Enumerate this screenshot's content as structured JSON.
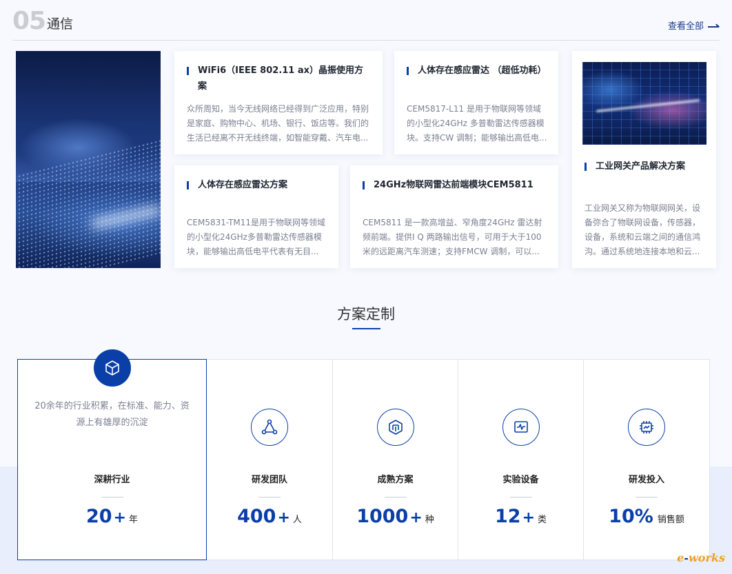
{
  "header": {
    "number": "05",
    "title": "通信",
    "view_all": "查看全部"
  },
  "cards": [
    {
      "title": "WiFi6（IEEE 802.11 ax）晶振使用方案",
      "desc": "众所周知，当今无线网络已经得到广泛应用，特别是家庭、购物中心、机场、银行、饭店等。我们的生活已经离不开无线终端，如智能穿戴、汽车电..."
    },
    {
      "title": "人体存在感应雷达 （超低功耗）",
      "desc": "CEM5817-L11 是用于物联网等领域的小型化24GHz 多普勒雷达传感器模块。支持CW 调制；能够输出高低电..."
    },
    {
      "title": "人体存在感应雷达方案",
      "desc": "CEM5831-TM11是用于物联网等领域的小型化24GHz多普勒雷达传感器模块，能够输出高低电平代表有无目..."
    },
    {
      "title": "24GHz物联网雷达前端模块CEM5811",
      "desc": "CEM5811 是一款高增益、窄角度24GHz 雷达射频前端。提供I Q 两路输出信号，可用于大于100米的远距离汽车测速；支持FMCW 调制，可以..."
    },
    {
      "title": "工业网关产品解决方案",
      "desc": "工业网关又称为物联网网关，设备弥合了物联网设备，传感器，设备，系统和云端之间的通信鸿沟。通过系统地连接本地和云..."
    }
  ],
  "customize": {
    "title": "方案定制",
    "stats": [
      {
        "label": "深耕行业",
        "num": "20",
        "plus": "+",
        "unit": "年",
        "icon": "cube-icon",
        "desc": "20余年的行业积累，在标准、能力、资源上有雄厚的沉淀"
      },
      {
        "label": "研发团队",
        "num": "400",
        "plus": "+",
        "unit": "人",
        "icon": "network-icon"
      },
      {
        "label": "成熟方案",
        "num": "1000",
        "plus": "+",
        "unit": "种",
        "icon": "layers-icon"
      },
      {
        "label": "实验设备",
        "num": "12",
        "plus": "+",
        "unit": "类",
        "icon": "monitor-wave-icon"
      },
      {
        "label": "研发投入",
        "num": "10%",
        "plus": "",
        "unit": "销售额",
        "icon": "chip-icon"
      }
    ]
  },
  "logo": {
    "text_left": "e",
    "text_right": "works"
  },
  "colors": {
    "accent": "#0a3fa8",
    "text": "#333333",
    "muted": "#7a8090"
  }
}
